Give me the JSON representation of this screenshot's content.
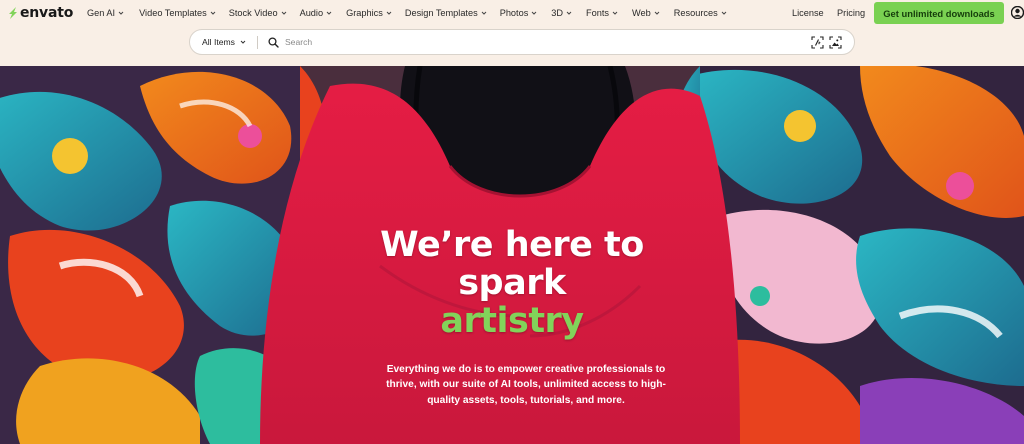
{
  "brand": {
    "name": "envato",
    "accent": "#82d35a",
    "cta_color": "#7ad152",
    "bg": "#f9efe6"
  },
  "nav": {
    "items": [
      {
        "label": "Gen AI",
        "icon": "chevron-down-icon"
      },
      {
        "label": "Video Templates",
        "icon": "chevron-down-icon"
      },
      {
        "label": "Stock Video",
        "icon": "chevron-down-icon"
      },
      {
        "label": "Audio",
        "icon": "chevron-down-icon"
      },
      {
        "label": "Graphics",
        "icon": "chevron-down-icon"
      },
      {
        "label": "Design Templates",
        "icon": "chevron-down-icon"
      },
      {
        "label": "Photos",
        "icon": "chevron-down-icon"
      },
      {
        "label": "3D",
        "icon": "chevron-down-icon"
      },
      {
        "label": "Fonts",
        "icon": "chevron-down-icon"
      },
      {
        "label": "Web",
        "icon": "chevron-down-icon"
      },
      {
        "label": "Resources",
        "icon": "chevron-down-icon"
      }
    ],
    "license": "License",
    "pricing": "Pricing",
    "cta": "Get unlimited downloads",
    "account_icon": "user-account-icon"
  },
  "search": {
    "category": "All Items",
    "placeholder": "Search",
    "icons": [
      "search-icon",
      "ai-search-icon",
      "image-search-icon"
    ]
  },
  "hero": {
    "title_line1": "We’re here to",
    "title_line2": "spark",
    "title_accent": "artistry",
    "subtitle": "Everything we do is to empower creative professionals to thrive, with our suite of AI tools, unlimited access to high-quality assets, tools, tutorials, and more."
  }
}
